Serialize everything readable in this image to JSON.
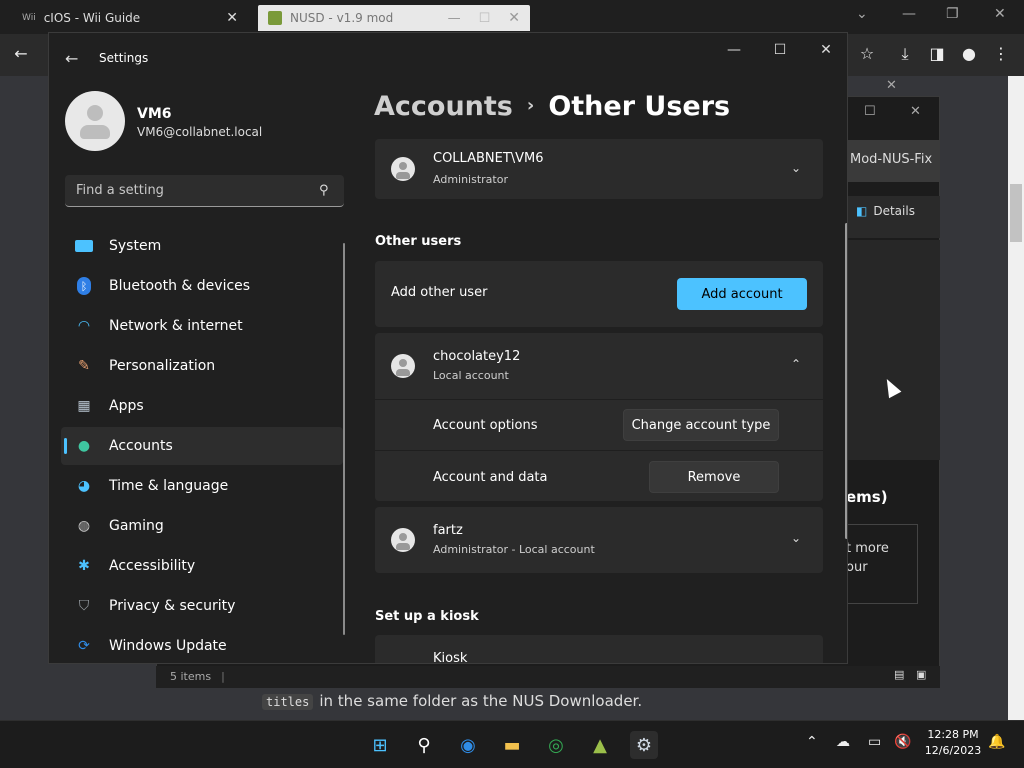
{
  "browser": {
    "tabs": [
      {
        "favicon": "Wii",
        "title": "cIOS - Wii Guide"
      },
      {
        "title": "NUSD - v1.9 mod"
      }
    ]
  },
  "background_page": {
    "code": "titles",
    "text": "in the same folder as the NUS Downloader.",
    "window": {
      "title_fragment": "Mod-NUS-Fix",
      "details_label": "Details",
      "items_fragment": "ems)",
      "card_line1": "t more",
      "card_line2": "our",
      "status": "5 items"
    }
  },
  "settings": {
    "window_title": "Settings",
    "profile": {
      "name": "VM6",
      "email": "VM6@collabnet.local"
    },
    "search_placeholder": "Find a setting",
    "nav": [
      {
        "label": "System",
        "icon": "monitor-icon"
      },
      {
        "label": "Bluetooth & devices",
        "icon": "bluetooth-icon"
      },
      {
        "label": "Network & internet",
        "icon": "wifi-icon"
      },
      {
        "label": "Personalization",
        "icon": "paintbrush-icon"
      },
      {
        "label": "Apps",
        "icon": "apps-icon"
      },
      {
        "label": "Accounts",
        "icon": "person-icon",
        "active": true
      },
      {
        "label": "Time & language",
        "icon": "globe-clock-icon"
      },
      {
        "label": "Gaming",
        "icon": "gamepad-icon"
      },
      {
        "label": "Accessibility",
        "icon": "accessibility-icon"
      },
      {
        "label": "Privacy & security",
        "icon": "shield-icon"
      },
      {
        "label": "Windows Update",
        "icon": "update-icon"
      }
    ],
    "breadcrumb": {
      "parent": "Accounts",
      "separator": "›",
      "current": "Other Users"
    },
    "current_user": {
      "name": "COLLABNET\\VM6",
      "type": "Administrator"
    },
    "other_users_heading": "Other users",
    "add_other_user": {
      "label": "Add other user",
      "button": "Add account"
    },
    "users": [
      {
        "name": "chocolatey12",
        "type": "Local account",
        "expanded": true,
        "options": [
          {
            "label": "Account options",
            "button": "Change account type"
          },
          {
            "label": "Account and data",
            "button": "Remove"
          }
        ]
      },
      {
        "name": "fartz",
        "type": "Administrator - Local account",
        "expanded": false
      }
    ],
    "kiosk_heading": "Set up a kiosk",
    "kiosk_label": "Kiosk"
  },
  "taskbar": {
    "time": "12:28 PM",
    "date": "12/6/2023"
  },
  "colors": {
    "accent": "#4cc2ff",
    "background": "#202020",
    "card": "#2b2b2b"
  }
}
